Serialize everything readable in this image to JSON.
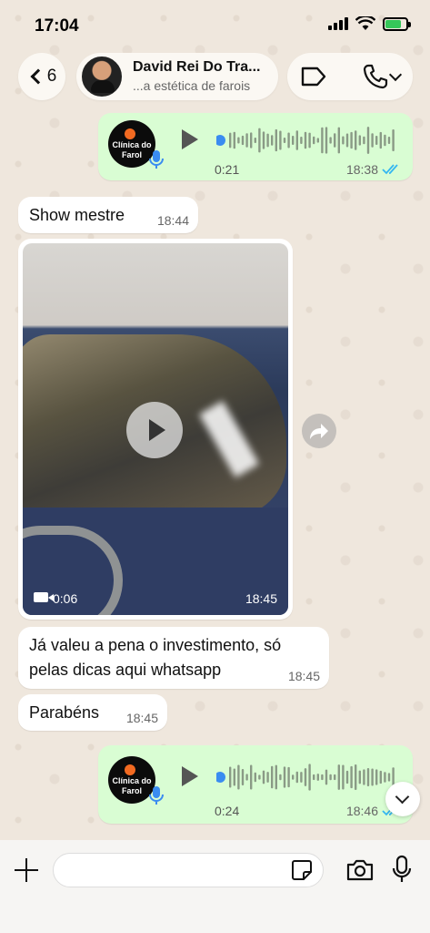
{
  "status_bar": {
    "time": "17:04"
  },
  "header": {
    "unread_count": "6",
    "contact_name": "David Rei Do Tra...",
    "contact_status": "...a estética de farois"
  },
  "messages": [
    {
      "id": "voice1",
      "type": "voice",
      "direction": "out",
      "avatar_text": "Clínica do Farol",
      "duration": "0:21",
      "time": "18:38",
      "read": true
    },
    {
      "id": "text1",
      "type": "text",
      "direction": "in",
      "text": "Show mestre",
      "time": "18:44"
    },
    {
      "id": "video1",
      "type": "video",
      "direction": "in",
      "duration": "0:06",
      "time": "18:45"
    },
    {
      "id": "text2",
      "type": "text",
      "direction": "in",
      "line1": "Já valeu a pena o investimento, só",
      "line2": "pelas dicas aqui whatsapp",
      "time": "18:45"
    },
    {
      "id": "text3",
      "type": "text",
      "direction": "in",
      "text": "Parabéns",
      "time": "18:45"
    },
    {
      "id": "voice2",
      "type": "voice",
      "direction": "out",
      "avatar_text": "Clínica do Farol",
      "duration": "0:24",
      "time": "18:46",
      "read": true
    }
  ],
  "composer": {
    "placeholder": ""
  },
  "colors": {
    "outgoing_bubble": "#d9fdd3",
    "incoming_bubble": "#ffffff",
    "read_ticks": "#34b7f1",
    "brand_dot": "#f26a21",
    "voice_progress": "#3a8cf0"
  },
  "icons": [
    "back-chevron-icon",
    "label-icon",
    "phone-icon",
    "play-icon",
    "mic-icon",
    "forward-icon",
    "video-camera-icon",
    "plus-icon",
    "sticker-icon",
    "camera-icon",
    "scroll-down-icon"
  ]
}
